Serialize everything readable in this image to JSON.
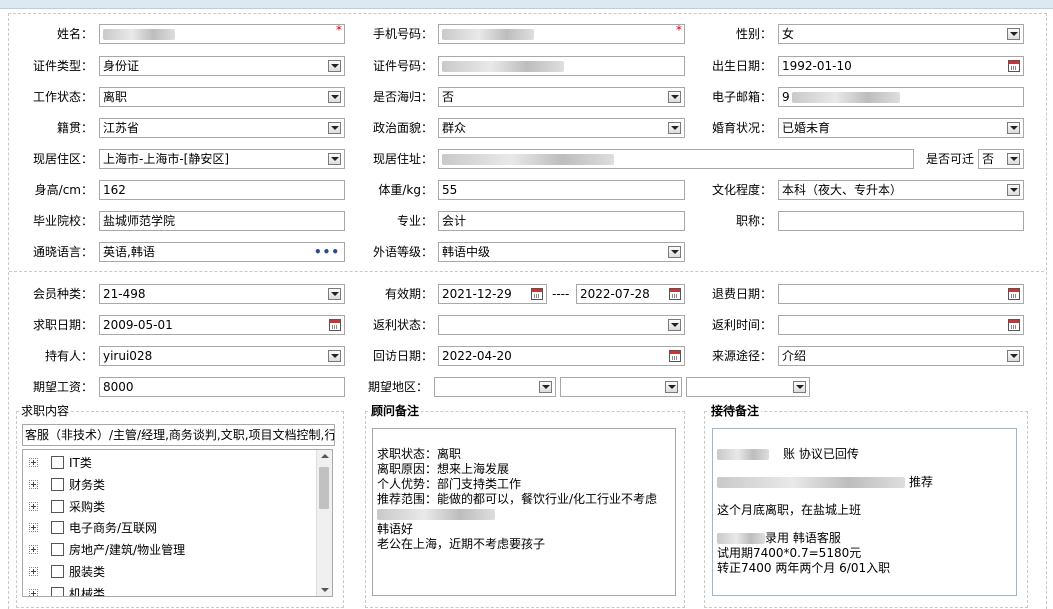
{
  "basic": {
    "name": {
      "label": "姓名：",
      "value": ""
    },
    "phone": {
      "label": "手机号码：",
      "value": ""
    },
    "gender": {
      "label": "性别：",
      "value": "女"
    },
    "id_type": {
      "label": "证件类型：",
      "value": "身份证"
    },
    "id_number": {
      "label": "证件号码：",
      "value": ""
    },
    "birth_date": {
      "label": "出生日期：",
      "value": "1992-01-10"
    },
    "work_status": {
      "label": "工作状态：",
      "value": "离职"
    },
    "overseas_return": {
      "label": "是否海归：",
      "value": "否"
    },
    "email": {
      "label": "电子邮箱：",
      "value": "9"
    },
    "native_place": {
      "label": "籍贯：",
      "value": "江苏省"
    },
    "political_status": {
      "label": "政治面貌：",
      "value": "群众"
    },
    "marital_status": {
      "label": "婚育状况：",
      "value": "已婚未育"
    },
    "current_area": {
      "label": "现居住区：",
      "value": "上海市-上海市-[静安区]"
    },
    "current_address": {
      "label": "现居住址：",
      "value": ""
    },
    "relocate": {
      "label": "是否可迁",
      "value": "否"
    },
    "height": {
      "label": "身高/cm：",
      "value": "162"
    },
    "weight": {
      "label": "体重/kg：",
      "value": "55"
    },
    "education": {
      "label": "文化程度：",
      "value": "本科（夜大、专升本）"
    },
    "school": {
      "label": "毕业院校：",
      "value": "盐城师范学院"
    },
    "major": {
      "label": "专业：",
      "value": "会计"
    },
    "title": {
      "label": "职称：",
      "value": ""
    },
    "languages": {
      "label": "通晓语言：",
      "value": "英语,韩语"
    },
    "foreign_level": {
      "label": "外语等级：",
      "value": "韩语中级"
    }
  },
  "member": {
    "member_type": {
      "label": "会员种类：",
      "value": "21-498"
    },
    "validity": {
      "label": "有效期：",
      "start": "2021-12-29",
      "separator": "----",
      "end": "2022-07-28"
    },
    "refund_date": {
      "label": "退费日期：",
      "value": ""
    },
    "job_seek_date": {
      "label": "求职日期：",
      "value": "2009-05-01"
    },
    "rebate_status": {
      "label": "返利状态：",
      "value": ""
    },
    "rebate_time": {
      "label": "返利时间：",
      "value": ""
    },
    "holder": {
      "label": "持有人：",
      "value": "yirui028"
    },
    "visit_date": {
      "label": "回访日期：",
      "value": "2022-04-20"
    },
    "source": {
      "label": "来源途径：",
      "value": "介绍"
    },
    "expected_salary": {
      "label": "期望工资：",
      "value": "8000"
    },
    "expected_region": {
      "label": "期望地区：",
      "value1": "",
      "value2": "",
      "value3": ""
    }
  },
  "job_content": {
    "title": "求职内容",
    "selected": "客服（非技术）/主管/经理,商务谈判,文职,项目文档控制,行",
    "categories": [
      "IT类",
      "财务类",
      "采购类",
      "电子商务/互联网",
      "房地产/建筑/物业管理",
      "服装类",
      "机械类"
    ]
  },
  "advisor_notes": {
    "title": "顾问备注",
    "lines": [
      "求职状态：离职",
      "离职原因：想来上海发展",
      "个人优势：部门支持类工作",
      "推荐范围：能做的都可以，餐饮行业/化工行业不考虑",
      "",
      "韩语好",
      "老公在上海，近期不考虑要孩子"
    ]
  },
  "reception_notes": {
    "title": "接待备注",
    "lines": [
      "账 协议已回传",
      "推荐",
      "",
      "这个月底离职，在盐城上班",
      "",
      "录用 韩语客服",
      "试用期7400*0.7=5180元",
      "转正7400 两年两个月 6/01入职"
    ]
  },
  "colors": {
    "required": "#dd0000",
    "border": "#a8a8a8",
    "topbar": "#dde8f1"
  }
}
